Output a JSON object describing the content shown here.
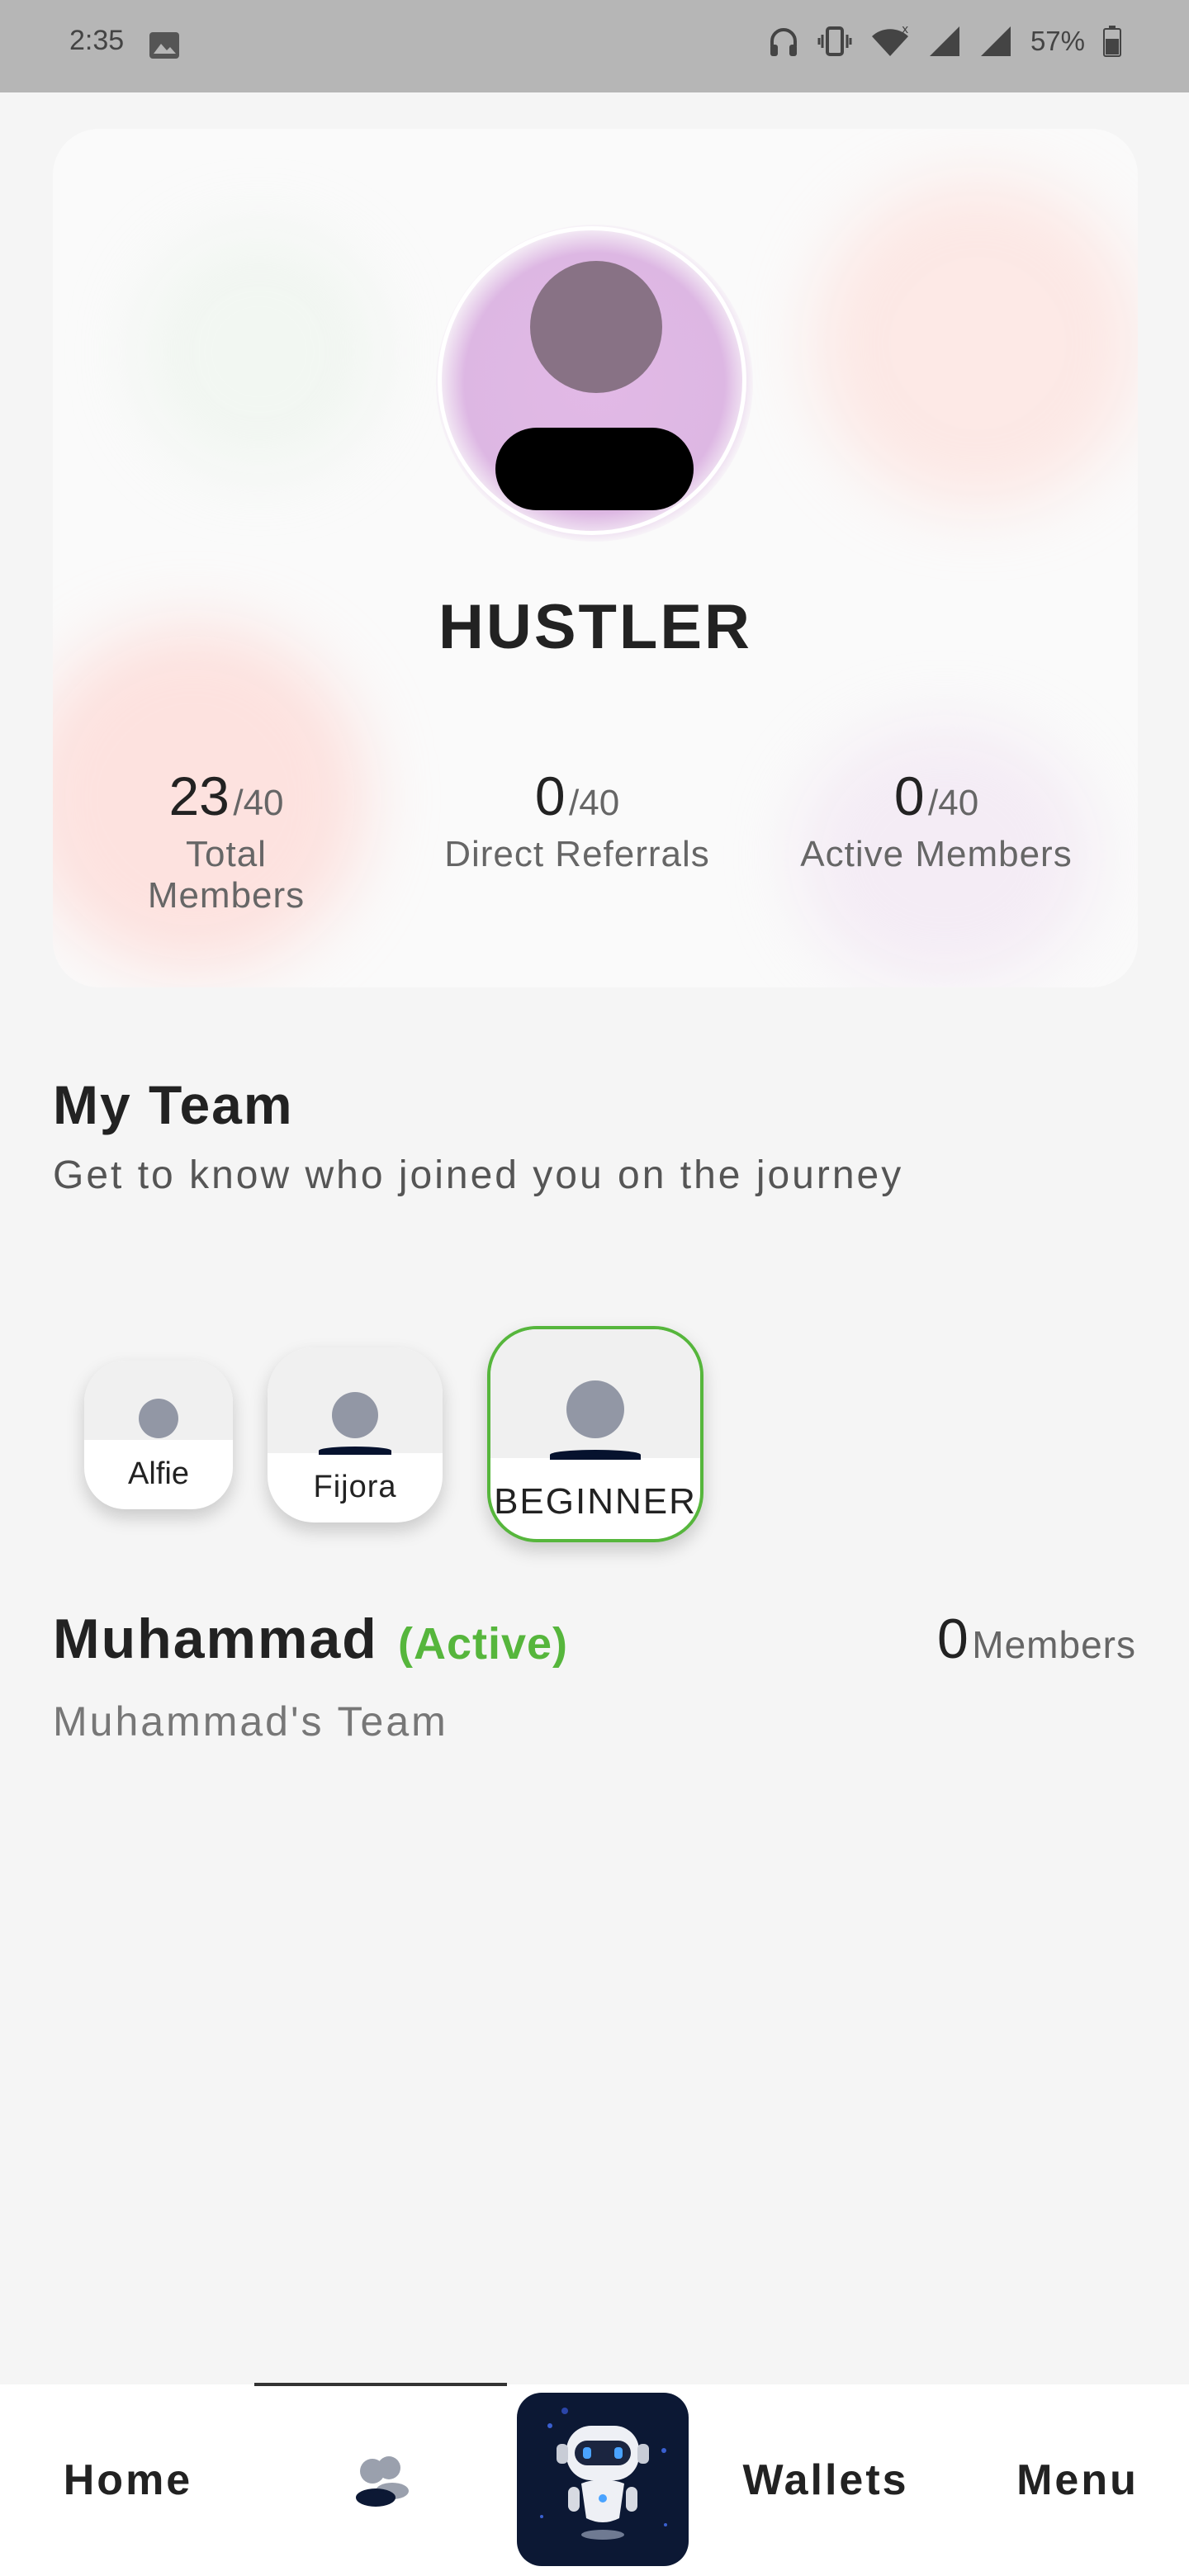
{
  "status_bar": {
    "time": "2:35",
    "battery": "57%"
  },
  "profile": {
    "rank": "HUSTLER",
    "stats": [
      {
        "value": "23",
        "max": "/40",
        "label": "Total Members"
      },
      {
        "value": "0",
        "max": "/40",
        "label": "Direct Referrals"
      },
      {
        "value": "0",
        "max": "/40",
        "label": "Active Members"
      }
    ]
  },
  "team": {
    "title": "My Team",
    "subtitle": "Get to know who joined you on the journey",
    "members": [
      {
        "label": "Alfie"
      },
      {
        "label": "Fijora"
      },
      {
        "label": "BEGINNER"
      }
    ],
    "selected": {
      "name": "Muhammad",
      "status": "(Active)",
      "members_count": "0",
      "members_label": "Members",
      "team_name": "Muhammad's Team"
    }
  },
  "nav": {
    "items": [
      {
        "label": "Home"
      },
      {
        "label": "Team"
      },
      {
        "label": "Bot"
      },
      {
        "label": "Wallets"
      },
      {
        "label": "Menu"
      }
    ]
  },
  "colors": {
    "active_green": "#56b63c",
    "dark_navy": "#0c1834",
    "status_bar": "#b6b6b6"
  }
}
